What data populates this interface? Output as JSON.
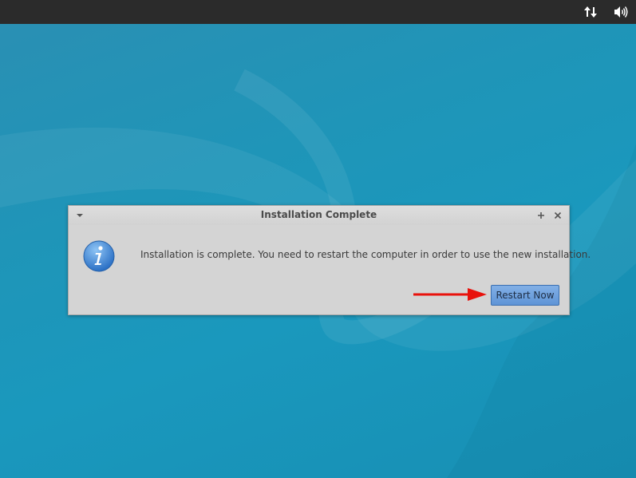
{
  "panel": {
    "tray_icons": [
      "network-updown-icon",
      "volume-icon"
    ]
  },
  "dialog": {
    "title": "Installation Complete",
    "message": "Installation is complete. You need to restart the computer in order to use the new installation.",
    "icon": "info-icon",
    "restart_button_label": "Restart Now",
    "window_controls": [
      "menu-icon",
      "maximize-icon",
      "close-icon"
    ]
  },
  "annotation": {
    "arrow_color": "#e8120c"
  },
  "colors": {
    "panel_bg": "#2b2b2b",
    "desktop_bg": "#1f95b8",
    "dialog_bg": "#d4d4d4",
    "button_bg": "#6a9ddc"
  }
}
